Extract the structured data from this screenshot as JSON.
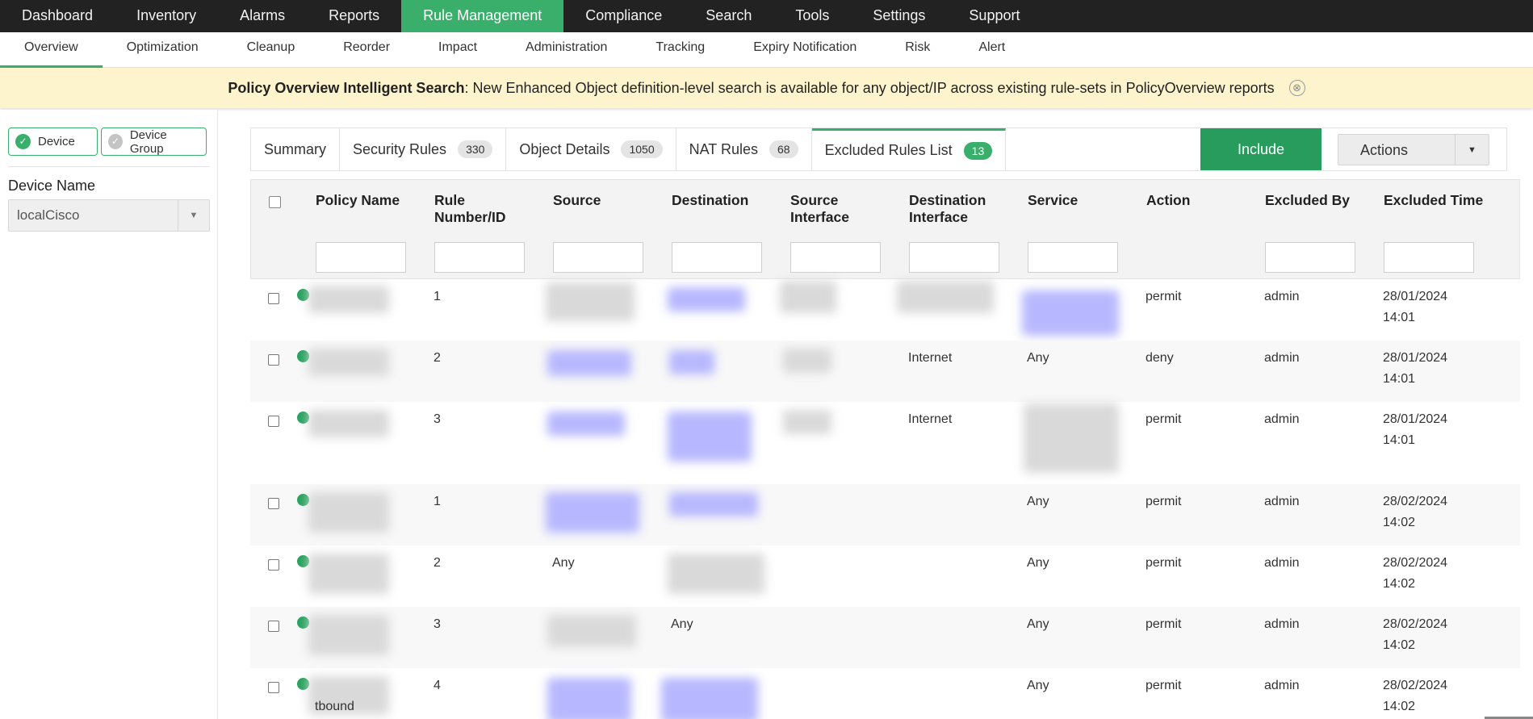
{
  "topnav": {
    "items": [
      {
        "label": "Dashboard"
      },
      {
        "label": "Inventory"
      },
      {
        "label": "Alarms"
      },
      {
        "label": "Reports"
      },
      {
        "label": "Rule Management",
        "active": true
      },
      {
        "label": "Compliance"
      },
      {
        "label": "Search"
      },
      {
        "label": "Tools"
      },
      {
        "label": "Settings"
      },
      {
        "label": "Support"
      }
    ]
  },
  "subnav": {
    "items": [
      {
        "label": "Overview",
        "active": true
      },
      {
        "label": "Optimization"
      },
      {
        "label": "Cleanup"
      },
      {
        "label": "Reorder"
      },
      {
        "label": "Impact"
      },
      {
        "label": "Administration"
      },
      {
        "label": "Tracking"
      },
      {
        "label": "Expiry Notification"
      },
      {
        "label": "Risk"
      },
      {
        "label": "Alert"
      }
    ]
  },
  "banner": {
    "title": "Policy Overview Intelligent Search",
    "message": ": New Enhanced Object definition-level search is available for any object/IP across existing rule-sets in PolicyOverview reports",
    "close_icon": "⊗"
  },
  "sidebar": {
    "device_label": "Device",
    "device_group_label": "Device Group",
    "device_name_label": "Device Name",
    "selected_device": "localCisco"
  },
  "tabs": [
    {
      "label": "Summary"
    },
    {
      "label": "Security Rules",
      "count": "330"
    },
    {
      "label": "Object Details",
      "count": "1050"
    },
    {
      "label": "NAT Rules",
      "count": "68"
    },
    {
      "label": "Excluded Rules List",
      "count": "13",
      "active": true
    }
  ],
  "toolbar": {
    "include_label": "Include",
    "actions_label": "Actions"
  },
  "table": {
    "columns": [
      {
        "key": "policy_name",
        "label": "Policy Name",
        "filter": true
      },
      {
        "key": "rule_number",
        "label": "Rule Number/ID",
        "filter": true
      },
      {
        "key": "source",
        "label": "Source",
        "filter": true
      },
      {
        "key": "destination",
        "label": "Destination",
        "filter": true
      },
      {
        "key": "source_interface",
        "label": "Source Interface",
        "filter": true
      },
      {
        "key": "destination_interface",
        "label": "Destination Interface",
        "filter": true
      },
      {
        "key": "service",
        "label": "Service",
        "filter": true
      },
      {
        "key": "action",
        "label": "Action",
        "filter": false
      },
      {
        "key": "excluded_by",
        "label": "Excluded By",
        "filter": true
      },
      {
        "key": "excluded_time",
        "label": "Excluded Time",
        "filter": true
      }
    ],
    "rows": [
      {
        "rule_number": "1",
        "source": "",
        "destination": "",
        "source_interface": "",
        "destination_interface": "",
        "service": "",
        "action": "permit",
        "excluded_by": "admin",
        "excluded_time": [
          "28/01/2024",
          "14:01"
        ]
      },
      {
        "rule_number": "2",
        "source": "",
        "destination": "",
        "source_interface": "",
        "destination_interface": "Internet",
        "service": "Any",
        "action": "deny",
        "excluded_by": "admin",
        "excluded_time": [
          "28/01/2024",
          "14:01"
        ]
      },
      {
        "rule_number": "3",
        "source": "",
        "destination": "",
        "source_interface": "",
        "destination_interface": "Internet",
        "service": "",
        "action": "permit",
        "excluded_by": "admin",
        "excluded_time": [
          "28/01/2024",
          "14:01"
        ]
      },
      {
        "rule_number": "1",
        "source": "",
        "destination": "",
        "source_interface": "",
        "destination_interface": "",
        "service": "Any",
        "action": "permit",
        "excluded_by": "admin",
        "excluded_time": [
          "28/02/2024",
          "14:02"
        ]
      },
      {
        "rule_number": "2",
        "source": "Any",
        "destination": "",
        "source_interface": "",
        "destination_interface": "",
        "service": "Any",
        "action": "permit",
        "excluded_by": "admin",
        "excluded_time": [
          "28/02/2024",
          "14:02"
        ]
      },
      {
        "rule_number": "3",
        "source": "",
        "destination": "Any",
        "source_interface": "",
        "destination_interface": "",
        "service": "Any",
        "action": "permit",
        "excluded_by": "admin",
        "excluded_time": [
          "28/02/2024",
          "14:02"
        ]
      },
      {
        "rule_number": "4",
        "policy_name_visible": "tbound",
        "source": "",
        "destination": "",
        "source_interface": "",
        "destination_interface": "",
        "service": "Any",
        "action": "permit",
        "excluded_by": "admin",
        "excluded_time": [
          "28/02/2024",
          "14:02"
        ]
      }
    ]
  },
  "colors": {
    "accent": "#3aae6b",
    "include_button": "#279c5c",
    "topnav_bg": "#222222",
    "banner_bg": "#fdf4cd",
    "status_dot": "#27a35e"
  }
}
